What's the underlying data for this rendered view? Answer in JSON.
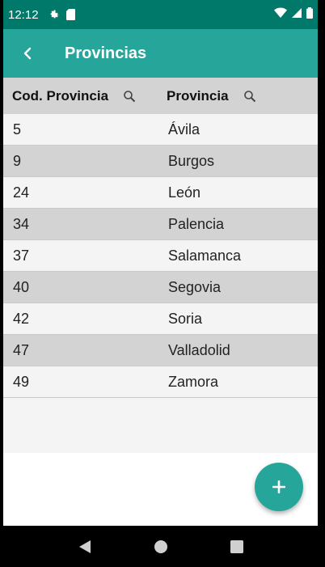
{
  "status_bar": {
    "time": "12:12",
    "icons": [
      "settings-icon",
      "sd-card-icon",
      "wifi-icon",
      "signal-icon",
      "battery-icon"
    ]
  },
  "app_bar": {
    "title": "Provincias",
    "back_icon": "chevron-left-icon"
  },
  "table": {
    "headers": [
      {
        "label": "Cod. Provincia",
        "icon": "search-icon"
      },
      {
        "label": "Provincia",
        "icon": "search-icon"
      }
    ],
    "rows": [
      {
        "code": "5",
        "name": "Ávila"
      },
      {
        "code": "9",
        "name": "Burgos"
      },
      {
        "code": "24",
        "name": "León"
      },
      {
        "code": "34",
        "name": "Palencia"
      },
      {
        "code": "37",
        "name": "Salamanca"
      },
      {
        "code": "40",
        "name": "Segovia"
      },
      {
        "code": "42",
        "name": "Soria"
      },
      {
        "code": "47",
        "name": "Valladolid"
      },
      {
        "code": "49",
        "name": "Zamora"
      }
    ]
  },
  "fab": {
    "icon": "plus-icon"
  },
  "nav_bar": {
    "icons": [
      "back-triangle-icon",
      "home-circle-icon",
      "recents-square-icon"
    ]
  },
  "colors": {
    "status_bar": "#00796b",
    "app_bar": "#26a69a",
    "accent": "#26a69a",
    "row_alt": "#d3d3d3",
    "row_plain": "#f4f4f4"
  }
}
